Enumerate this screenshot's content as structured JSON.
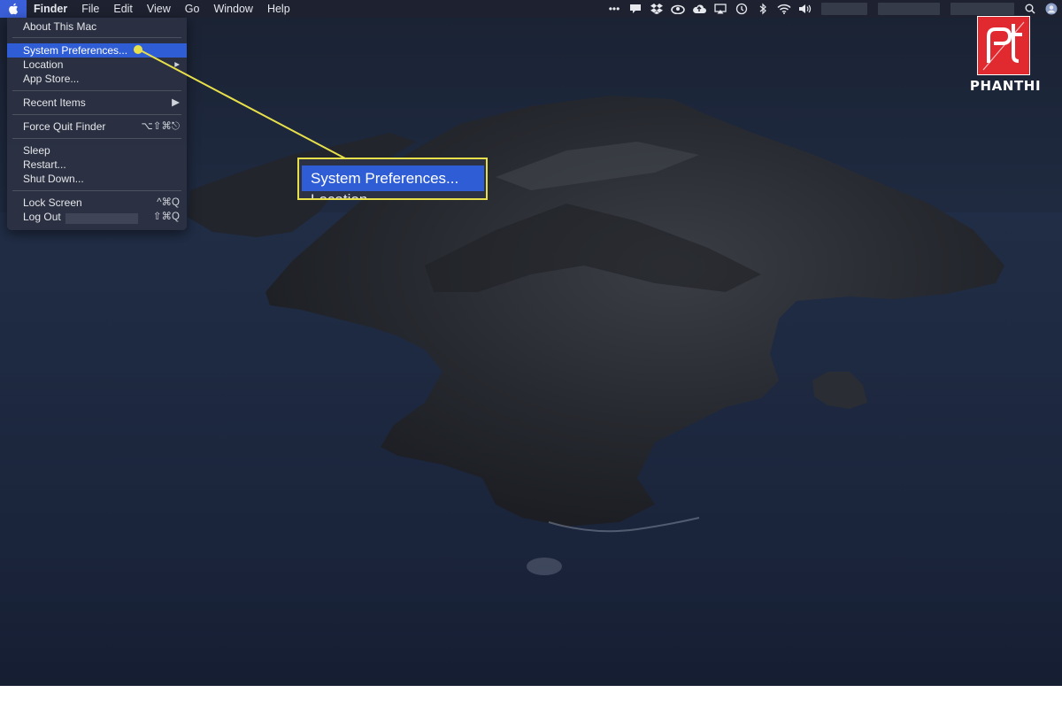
{
  "menubar": {
    "app_name": "Finder",
    "items": [
      "File",
      "Edit",
      "View",
      "Go",
      "Window",
      "Help"
    ]
  },
  "status_icons": [
    "dots-icon",
    "notification-icon",
    "dropbox-icon",
    "creative-cloud-icon",
    "cloud-upload-icon",
    "airplay-icon",
    "time-machine-icon",
    "bluetooth-icon",
    "wifi-icon",
    "volume-icon"
  ],
  "apple_menu": {
    "items": [
      {
        "label": "About This Mac",
        "shortcut": ""
      },
      {
        "label": "System Preferences...",
        "shortcut": "",
        "highlighted": true
      },
      {
        "label": "Location",
        "shortcut": "▸"
      },
      {
        "label": "App Store...",
        "shortcut": ""
      },
      {
        "label": "Recent Items",
        "shortcut": "▶"
      },
      {
        "label": "Force Quit Finder",
        "shortcut": "⌥⇧⌘⎋"
      },
      {
        "label": "Sleep",
        "shortcut": ""
      },
      {
        "label": "Restart...",
        "shortcut": ""
      },
      {
        "label": "Shut Down...",
        "shortcut": ""
      },
      {
        "label": "Lock Screen",
        "shortcut": "^⌘Q"
      },
      {
        "label": "Log Out",
        "shortcut": "⇧⌘Q"
      }
    ]
  },
  "callout": {
    "highlighted_label": "System Preferences...",
    "next_label": "Location",
    "accent_color": "#e8e04a"
  },
  "logo": {
    "text": "PHANTHI",
    "mark": "pt",
    "color": "#e02a2f"
  }
}
